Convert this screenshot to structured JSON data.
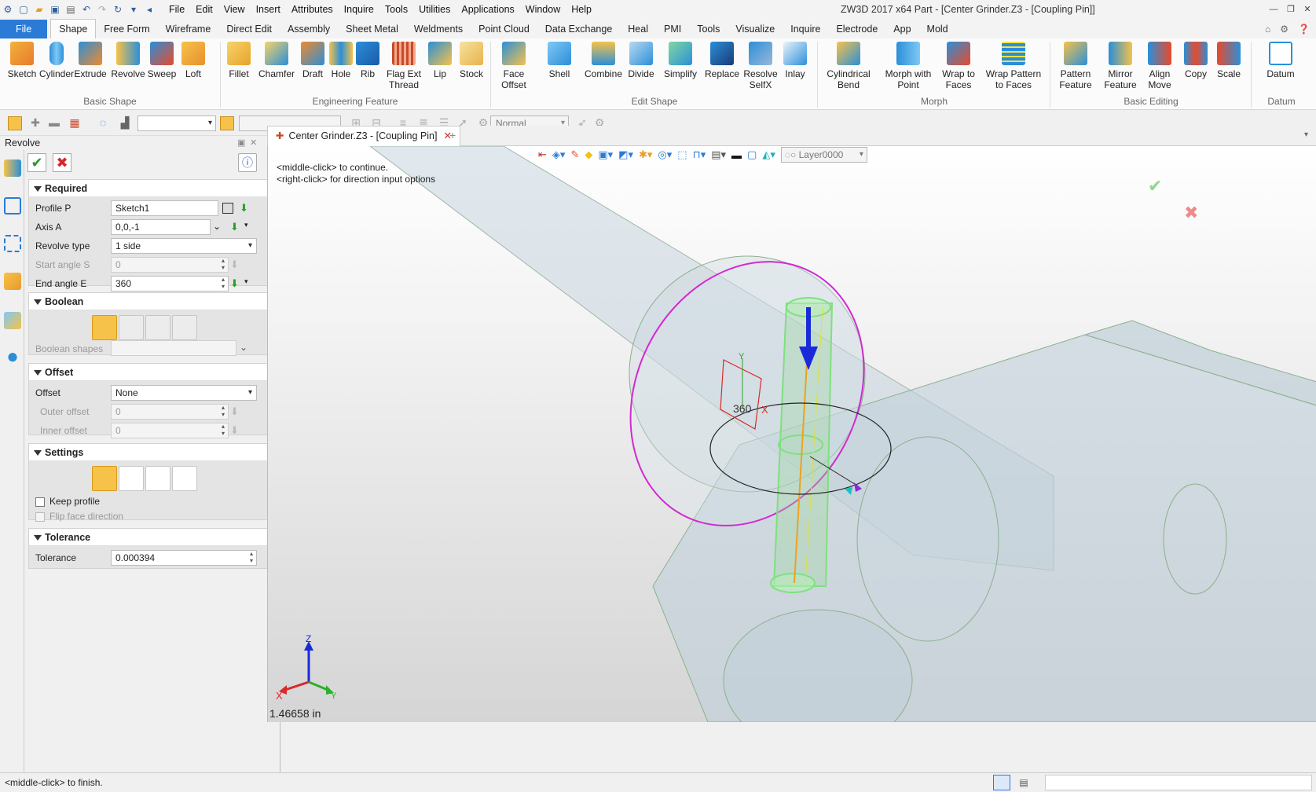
{
  "menu": [
    "File",
    "Edit",
    "View",
    "Insert",
    "Attributes",
    "Inquire",
    "Tools",
    "Utilities",
    "Applications",
    "Window",
    "Help"
  ],
  "app_title": "ZW3D 2017  x64      Part - [Center Grinder.Z3 - [Coupling Pin]]",
  "tabs": [
    "File",
    "Shape",
    "Free Form",
    "Wireframe",
    "Direct Edit",
    "Assembly",
    "Sheet Metal",
    "Weldments",
    "Point Cloud",
    "Data Exchange",
    "Heal",
    "PMI",
    "Tools",
    "Visualize",
    "Inquire",
    "Electrode",
    "App",
    "Mold"
  ],
  "ribbon": {
    "groups": [
      "Basic Shape",
      "Engineering Feature",
      "Edit Shape",
      "Morph",
      "Basic Editing",
      "Datum"
    ],
    "basic_shape": [
      "Sketch",
      "Cylinder",
      "Extrude",
      "Revolve",
      "Sweep",
      "Loft"
    ],
    "engineering": [
      "Fillet",
      "Chamfer",
      "Draft",
      "Hole",
      "Rib",
      "Flag Ext\nThread",
      "Lip",
      "Stock"
    ],
    "edit_shape": [
      "Face\nOffset",
      "Shell",
      "Combine",
      "Divide",
      "Simplify",
      "Replace",
      "Resolve\nSelfX",
      "Inlay"
    ],
    "morph": [
      "Cylindrical\nBend",
      "Morph with\nPoint",
      "Wrap to\nFaces",
      "Wrap Pattern\nto Faces"
    ],
    "basic_editing": [
      "Pattern\nFeature",
      "Mirror\nFeature",
      "Align\nMove",
      "Copy",
      "Scale"
    ],
    "datum": [
      "Datum"
    ]
  },
  "toolbar2": {
    "mode": "Normal"
  },
  "panel": {
    "title": "Revolve",
    "required": "Required",
    "profile_label": "Profile P",
    "profile_value": "Sketch1",
    "axis_label": "Axis A",
    "axis_value": "0,0,-1",
    "revolve_type_label": "Revolve type",
    "revolve_type_value": "1 side",
    "start_label": "Start angle S",
    "start_value": "0",
    "end_label": "End angle E",
    "end_value": "360",
    "boolean": "Boolean",
    "boolean_shapes": "Boolean shapes",
    "offset": "Offset",
    "offset_label": "Offset",
    "offset_value": "None",
    "outer_label": "Outer offset",
    "outer_value": "0",
    "inner_label": "Inner offset",
    "inner_value": "0",
    "settings": "Settings",
    "keep_profile": "Keep profile",
    "flip_face": "Flip face direction",
    "tolerance": "Tolerance",
    "tolerance_label": "Tolerance",
    "tolerance_value": "0.000394"
  },
  "doc_tab": "Center Grinder.Z3 - [Coupling Pin]",
  "viewport": {
    "hint1": "<middle-click> to continue.",
    "hint2": "<right-click> for direction input options",
    "angle_label": "360",
    "layer": "Layer0000",
    "distance": "1.46658 in",
    "axis_x": "X",
    "axis_y": "Y",
    "axis_z": "Z",
    "triad_x": "X",
    "triad_y": "Y",
    "triad_z": "Z"
  },
  "status": "<middle-click> to finish.",
  "colors": {
    "file_tab": "#2b7bd6",
    "accent": "#f6c24a",
    "magenta": "#d12ad1"
  }
}
